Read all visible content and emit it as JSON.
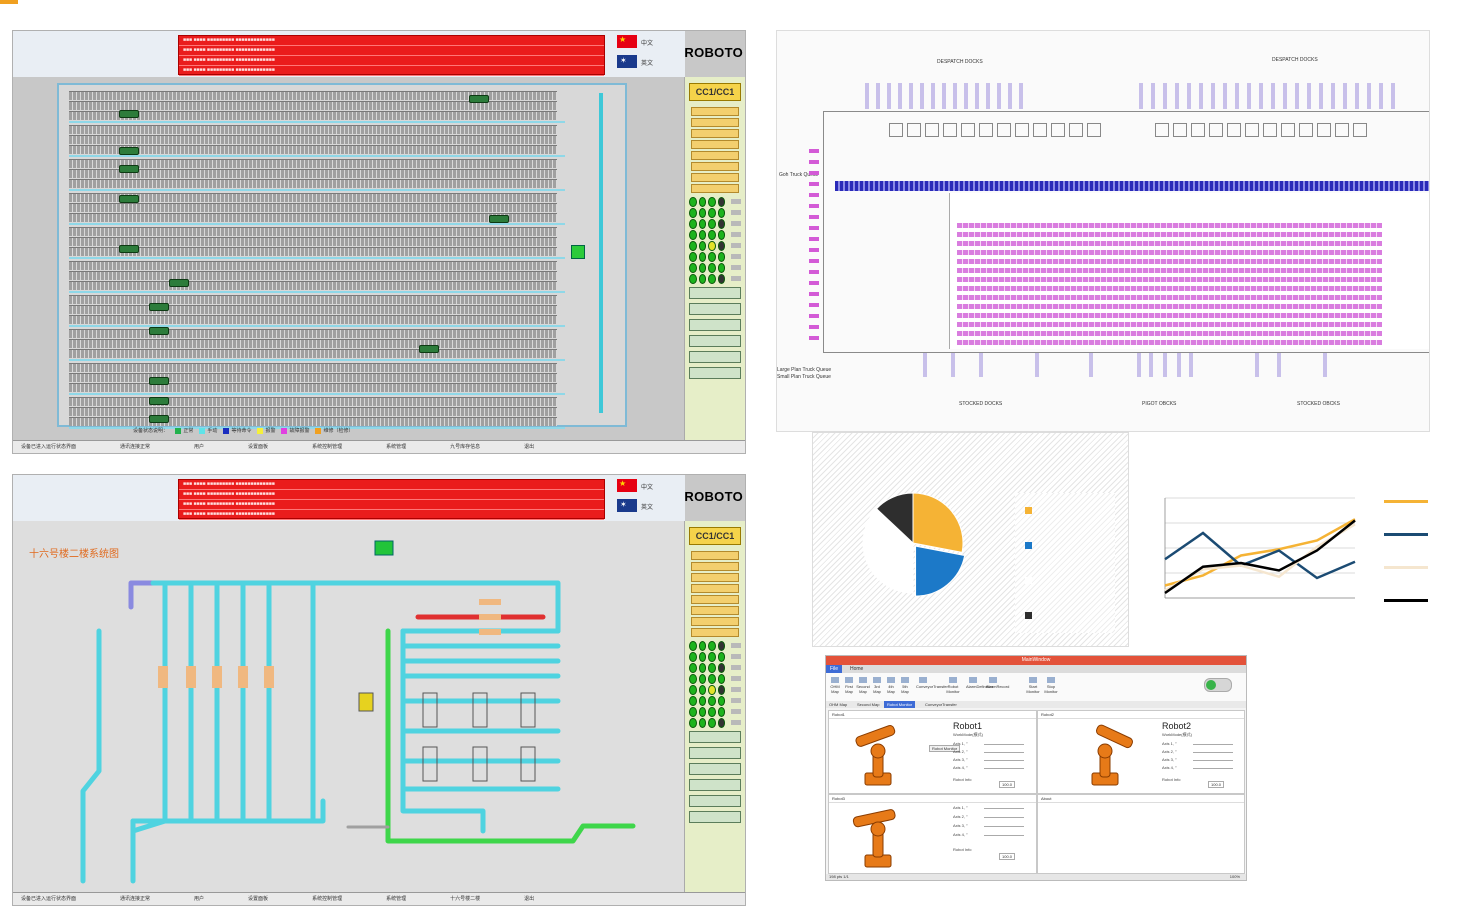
{
  "scada_top": {
    "brand": "ROBOTO",
    "lang_cn": "中文",
    "lang_en": "英文",
    "section_title": "CC1/CC1",
    "legend_title": "设备状态说明：",
    "legend": [
      {
        "label": "正常",
        "color": "#22b14c"
      },
      {
        "label": "手动",
        "color": "#5fe3e8"
      },
      {
        "label": "等待命令",
        "color": "#1a2dbf"
      },
      {
        "label": "报警",
        "color": "#f5f03a"
      },
      {
        "label": "故障报警",
        "color": "#e040e0"
      },
      {
        "label": "维修（检修）",
        "color": "#f0a020"
      }
    ],
    "status": [
      "设备已进入运行状态界面",
      "通讯连接正常",
      "用户",
      "设置面板",
      "系统控制管理",
      "系统管理",
      "九号库存信息",
      "退出"
    ]
  },
  "scada_bottom": {
    "brand": "ROBOTO",
    "lang_cn": "中文",
    "lang_en": "英文",
    "section_title": "CC1/CC1",
    "map_title": "十六号楼二楼系统图",
    "status": [
      "设备已进入运行状态界面",
      "通讯连接正常",
      "用户",
      "设置面板",
      "系统控制管理",
      "系统管理",
      "十六号楼二楼",
      "退出"
    ]
  },
  "layout": {
    "top_left_label": "DESPATCH DOCKS",
    "top_right_label": "DESPATCH DOCKS",
    "bottom_left_label": "STOCKED DOCKS",
    "bottom_mid_label": "PIGOT OBCKS",
    "bottom_right_label": "STOCKED OBCKS",
    "left_labels": [
      "Goh Truck Queue",
      "Large Plan Truck Queue",
      "Small Plan Truck Queue"
    ]
  },
  "chart_data": [
    {
      "type": "pie",
      "title": "",
      "slices": [
        {
          "label": "",
          "value": 28,
          "color": "#f5b335"
        },
        {
          "label": "",
          "value": 22,
          "color": "#1c79c8"
        },
        {
          "label": "",
          "value": 37,
          "color": "#ffffff"
        },
        {
          "label": "",
          "value": 13,
          "color": "#2e2e2e"
        }
      ],
      "legend": "right"
    },
    {
      "type": "line",
      "title": "",
      "x": [
        1,
        2,
        3,
        4,
        5,
        6
      ],
      "series": [
        {
          "values": [
            1.0,
            1.8,
            3.4,
            3.9,
            4.6,
            6.3
          ],
          "color": "#f5b335"
        },
        {
          "values": [
            3.1,
            5.2,
            2.6,
            3.8,
            1.6,
            2.9
          ],
          "color": "#1b4b73"
        },
        {
          "values": [
            0.6,
            2.3,
            2.6,
            1.7,
            4.1,
            5.9
          ],
          "color": "#f5e6cf"
        },
        {
          "values": [
            0.4,
            2.5,
            2.8,
            2.2,
            3.8,
            6.2
          ],
          "color": "#000000"
        }
      ],
      "ylim": [
        0,
        8
      ],
      "grid": true,
      "legend": "right"
    }
  ],
  "robot_app": {
    "window_title": "MainWindow",
    "tabs": [
      "File",
      "Home"
    ],
    "ribbon": [
      "OHM Map",
      "First Map",
      "Second Map",
      "3rd Map",
      "4th Map",
      "5th Map",
      "ConveyorTransfer",
      "Robot Monitor",
      "AlarmDefinition",
      "AlarmRecord",
      "Start Monitor",
      "Stop Monitor"
    ],
    "subtabs": [
      "OHM Map",
      "Second Map",
      "Robot Monitor",
      "ConveyorTransfer"
    ],
    "robot1": {
      "pane": "Robot1",
      "name": "Robot1",
      "mode": "WorkMode(模式)",
      "button": "Robot Monitor",
      "value": "100.0"
    },
    "robot2": {
      "pane": "Robot2",
      "name": "Robot2",
      "mode": "WorkMode(模式)",
      "value": "100.0"
    },
    "robot3": {
      "pane": "Robot3",
      "value": "100.0"
    },
    "about": {
      "pane": "About"
    },
    "axes": [
      "Axis 1, °",
      "Axis 2, °",
      "Axis 3, °",
      "Axis 4, °"
    ],
    "info": "Robot Info",
    "status_left": "198 pts 1/1",
    "status_right": "100%"
  }
}
